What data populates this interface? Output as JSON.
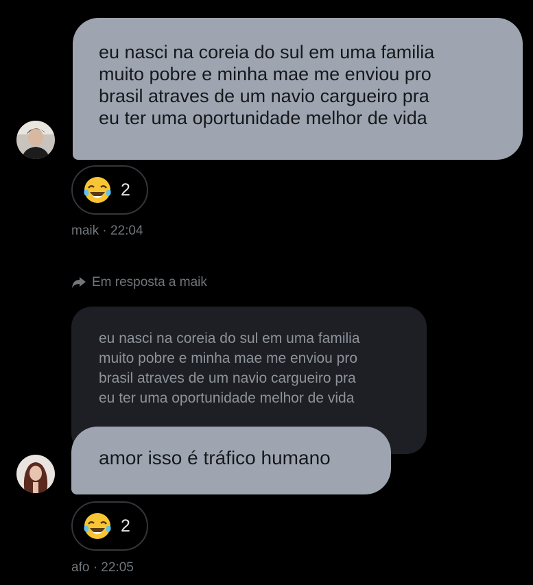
{
  "messages": [
    {
      "author": "maik",
      "time": "22:04",
      "text": "eu nasci na coreia do sul em uma familia\nmuito pobre e minha mae me enviou pro\nbrasil atraves de um navio cargueiro pra\neu ter uma oportunidade melhor de vida",
      "reaction": {
        "emoji": "😂",
        "count": "2"
      },
      "meta": "maik · 22:04"
    },
    {
      "author": "afo",
      "time": "22:05",
      "reply_label": "Em resposta a maik",
      "quoted_text": "eu nasci na coreia do sul em uma familia\nmuito pobre e minha mae me enviou pro\nbrasil atraves de um navio cargueiro pra\neu ter uma oportunidade melhor de vida",
      "text": "amor isso é tráfico humano",
      "reaction": {
        "emoji": "😂",
        "count": "2"
      },
      "meta": "afo · 22:05"
    }
  ],
  "colors": {
    "background": "#000000",
    "bubble": "#9ea5b0",
    "quoted_bubble": "#1d1f24",
    "meta_text": "#71767b",
    "reaction_border": "#33363b"
  },
  "icons": {
    "reaction_emoji": "face-with-tears-of-joy-icon",
    "reply": "reply-arrow-icon"
  }
}
